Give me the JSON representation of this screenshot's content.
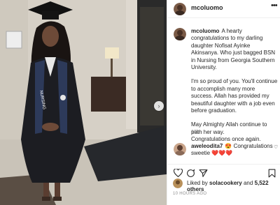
{
  "post": {
    "username": "mcoluomo",
    "more_icon": "ellipsis-icon",
    "caption_paragraphs": [
      "A hearty congratulations to my darling daughter Nofisat Ayinke Akinsanya. Who just bagged BSN in Nursing from Georgia Southern University.",
      "I'm so proud of you. You'll continue to accomplish many more success. Allah has provided my beautiful daughter with a job even before graduation.",
      "May Almighty Allah continue to path her way.\nCongratulations once again."
    ],
    "time_ago": "10h",
    "comment": {
      "username": "aweleodita7",
      "emoji": "😍",
      "text": "Congratulations sweetie",
      "hearts": "❤️❤️❤️"
    },
    "liked_by_prefix": "Liked by",
    "liked_by_user": "solacookery",
    "liked_by_and": "and",
    "liked_by_others": "5,522 others",
    "posted_ago": "10 HOURS AGO",
    "photo": {
      "sash_text": "NURSING"
    }
  },
  "colors": {
    "gown": "#1c1d22",
    "sash": "#2d3a5a",
    "wall": "#d9d4cc"
  }
}
